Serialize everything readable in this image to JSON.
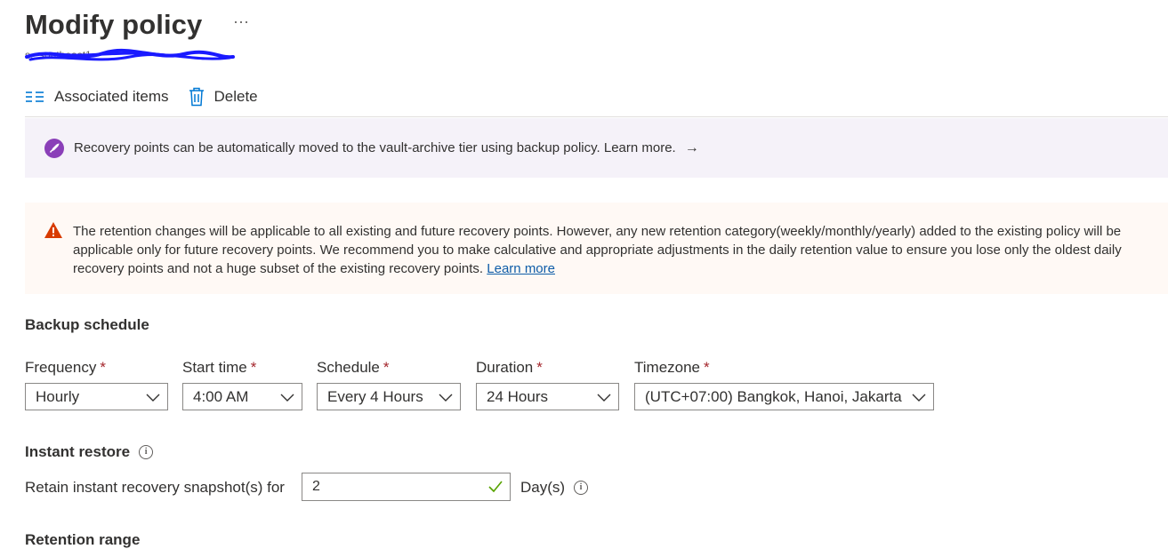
{
  "header": {
    "title": "Modify policy",
    "more_label": "···",
    "subtitle": "s...southeast1"
  },
  "toolbar": {
    "associated_items_label": "Associated items",
    "delete_label": "Delete"
  },
  "info_banner": {
    "text": "Recovery points can be automatically moved to the vault-archive tier using backup policy. Learn more.",
    "arrow": "→"
  },
  "warning_banner": {
    "text": "The retention changes will be applicable to all existing and future recovery points. However, any new retention category(weekly/monthly/yearly) added to the existing policy will be applicable only for future recovery points. We recommend you to make calculative and appropriate adjustments in the daily retention value to ensure you lose only the oldest daily recovery points and not a huge subset of the existing recovery points.",
    "link": "Learn more"
  },
  "backup_schedule": {
    "heading": "Backup schedule",
    "required_mark": "*",
    "fields": [
      {
        "label": "Frequency",
        "value": "Hourly"
      },
      {
        "label": "Start time",
        "value": "4:00 AM"
      },
      {
        "label": "Schedule",
        "value": "Every 4 Hours"
      },
      {
        "label": "Duration",
        "value": "24 Hours"
      },
      {
        "label": "Timezone",
        "value": "(UTC+07:00) Bangkok, Hanoi, Jakarta"
      }
    ]
  },
  "instant_restore": {
    "heading": "Instant restore",
    "retain_label": "Retain instant recovery snapshot(s) for",
    "value": "2",
    "unit": "Day(s)",
    "info_glyph": "i"
  },
  "retention_range": {
    "heading": "Retention range"
  },
  "colors": {
    "accent": "#0078d4",
    "info_bg": "#f5f2f9",
    "warning_bg": "#fff9f5",
    "warning_icon": "#d83b01",
    "required": "#a4262c",
    "valid_check": "#57a300"
  },
  "icons": {
    "associated_items": "list-icon",
    "delete": "trash-icon",
    "info_banner": "rocket-icon",
    "warning_banner": "warning-icon",
    "valid": "checkmark-icon"
  }
}
